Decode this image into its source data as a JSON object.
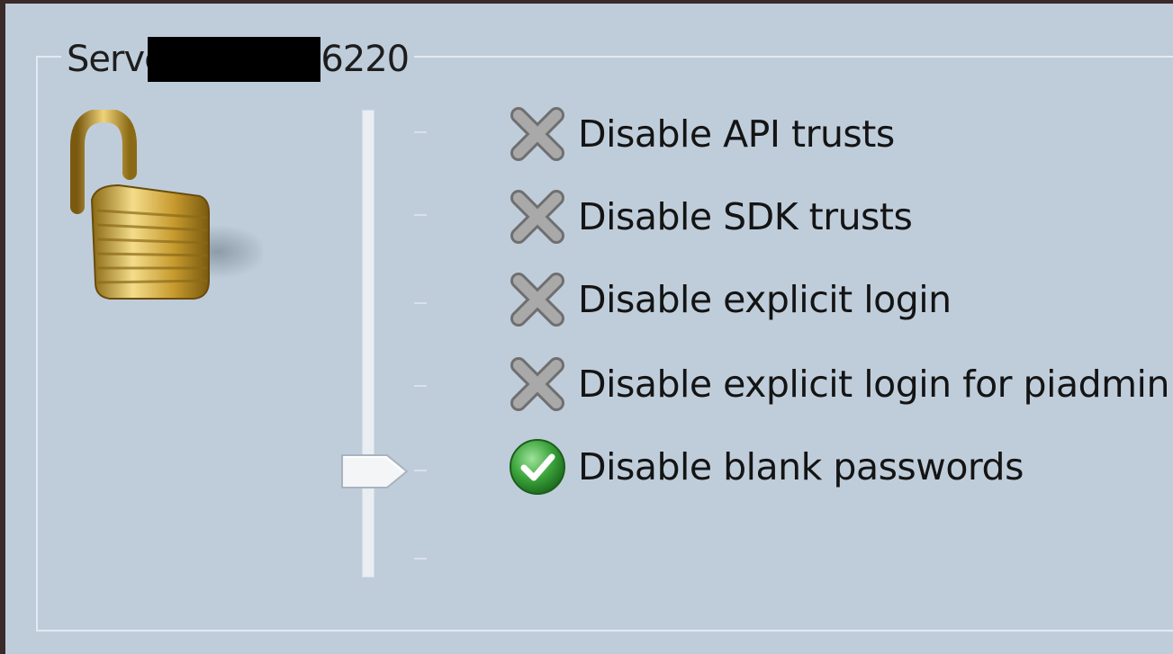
{
  "group": {
    "title_prefix": "Server -",
    "title_suffix": "6220"
  },
  "slider": {
    "level_index": 4,
    "levels": 6
  },
  "options": [
    {
      "label": "Disable API trusts",
      "status": "disabled",
      "icon": "gray-x-icon"
    },
    {
      "label": "Disable SDK trusts",
      "status": "disabled",
      "icon": "gray-x-icon"
    },
    {
      "label": "Disable explicit login",
      "status": "disabled",
      "icon": "gray-x-icon"
    },
    {
      "label": "Disable explicit login for piadmin",
      "status": "disabled",
      "icon": "gray-x-icon"
    },
    {
      "label": "Disable blank passwords",
      "status": "enabled",
      "icon": "green-check-icon"
    }
  ],
  "colors": {
    "panel": "#bfcddb",
    "check_green": "#3aa23a",
    "x_gray": "#8c8c8c",
    "lock_gold": "#c9a23a"
  }
}
